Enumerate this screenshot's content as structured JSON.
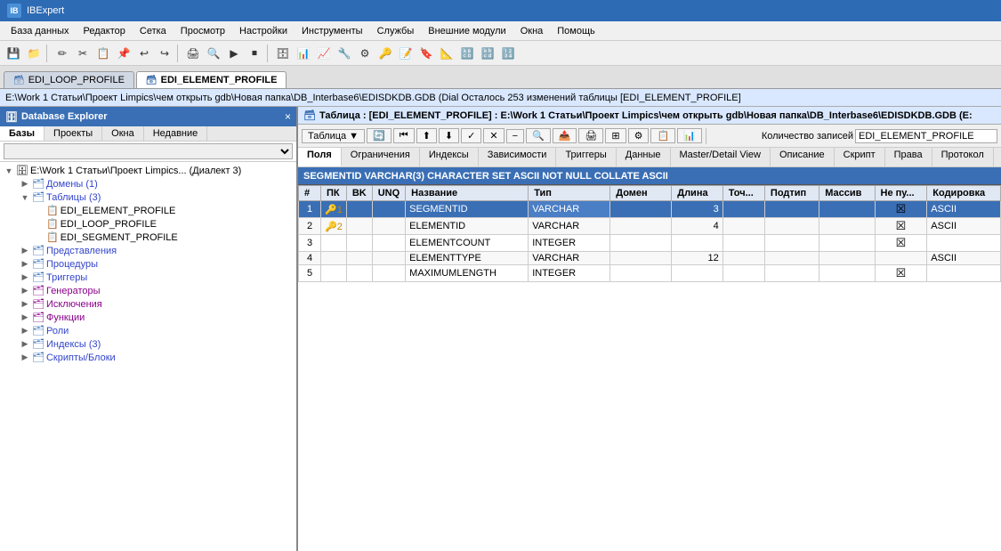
{
  "title_bar": {
    "icon": "IB",
    "title": "IBExpert"
  },
  "menu": {
    "items": [
      "База данных",
      "Редактор",
      "Сетка",
      "Просмотр",
      "Настройки",
      "Инструменты",
      "Службы",
      "Внешние модули",
      "Окна",
      "Помощь"
    ]
  },
  "tabs": [
    {
      "id": "edi_loop",
      "label": "EDI_LOOP_PROFILE",
      "active": false
    },
    {
      "id": "edi_element",
      "label": "EDI_ELEMENT_PROFILE",
      "active": true
    }
  ],
  "path_bar": {
    "text": "E:\\Work 1 Статьи\\Проект Limpics\\чем открыть gdb\\Новая папка\\DB_Interbase6\\EDISDKDB.GDB (Dial   Осталось 253 изменений таблицы [EDI_ELEMENT_PROFILE]"
  },
  "db_explorer": {
    "title": "Database Explorer",
    "close_btn": "×",
    "tabs": [
      "Базы",
      "Проекты",
      "Окна",
      "Недавние"
    ],
    "active_tab": "Базы",
    "filter_placeholder": "",
    "tree": {
      "root": {
        "label": "E:\\Work 1 Статьи\\Проект Limpics... (Диалект 3)",
        "expanded": true,
        "children": [
          {
            "label": "Домены (1)",
            "icon": "🗂",
            "expanded": false
          },
          {
            "label": "Таблицы (3)",
            "icon": "🗂",
            "expanded": true,
            "children": [
              {
                "label": "EDI_ELEMENT_PROFILE",
                "icon": "📋",
                "selected": false
              },
              {
                "label": "EDI_LOOP_PROFILE",
                "icon": "📋",
                "selected": false
              },
              {
                "label": "EDI_SEGMENT_PROFILE",
                "icon": "📋",
                "selected": false
              }
            ]
          },
          {
            "label": "Представления",
            "icon": "🗂",
            "expanded": false
          },
          {
            "label": "Процедуры",
            "icon": "🗂",
            "expanded": false
          },
          {
            "label": "Триггеры",
            "icon": "🗂",
            "expanded": false
          },
          {
            "label": "Генераторы",
            "icon": "🗂",
            "expanded": false
          },
          {
            "label": "Исключения",
            "icon": "🗂",
            "expanded": false
          },
          {
            "label": "Функции",
            "icon": "🗂",
            "expanded": false
          },
          {
            "label": "Роли",
            "icon": "🗂",
            "expanded": false
          },
          {
            "label": "Индексы (3)",
            "icon": "🗂",
            "expanded": false
          },
          {
            "label": "Скрипты/Блоки",
            "icon": "🗂",
            "expanded": false
          }
        ]
      }
    }
  },
  "right_panel": {
    "table_header": "Таблица : [EDI_ELEMENT_PROFILE] : E:\\Work 1 Статьи\\Проект Limpics\\чем открыть gdb\\Новая папка\\DB_Interbase6\\EDISDKDB.GDB (E:",
    "toolbar": {
      "table_btn": "Таблица ▼",
      "record_count_label": "Количество записей",
      "record_count_value": "EDI_ELEMENT_PROFILE"
    },
    "sub_tabs": [
      "Поля",
      "Ограничения",
      "Индексы",
      "Зависимости",
      "Триггеры",
      "Данные",
      "Master/Detail View",
      "Описание",
      "Скрипт",
      "Права",
      "Протокол"
    ],
    "active_sub_tab": "Поля",
    "sql_info": "SEGMENTID VARCHAR(3) CHARACTER SET ASCII NOT NULL COLLATE ASCII",
    "table": {
      "columns": [
        "#",
        "ПК",
        "BK",
        "UNQ",
        "Название",
        "Тип",
        "Домен",
        "Длина",
        "Точ...",
        "Подтип",
        "Массив",
        "Не пу...",
        "Кодировка"
      ],
      "rows": [
        {
          "num": "1",
          "pk": "🔑1",
          "bk": "",
          "unq": "",
          "name": "SEGMENTID",
          "type": "VARCHAR",
          "domain": "",
          "len": "3",
          "prec": "",
          "sub": "",
          "arr": "",
          "notnull": "☒",
          "enc": "ASCII",
          "selected": true
        },
        {
          "num": "2",
          "pk": "🔑2",
          "bk": "",
          "unq": "",
          "name": "ELEMENTID",
          "type": "VARCHAR",
          "domain": "",
          "len": "4",
          "prec": "",
          "sub": "",
          "arr": "",
          "notnull": "☒",
          "enc": "ASCII",
          "selected": false
        },
        {
          "num": "3",
          "pk": "",
          "bk": "",
          "unq": "",
          "name": "ELEMENTCOUNT",
          "type": "INTEGER",
          "domain": "",
          "len": "",
          "prec": "",
          "sub": "",
          "arr": "",
          "notnull": "☒",
          "enc": "",
          "selected": false
        },
        {
          "num": "4",
          "pk": "",
          "bk": "",
          "unq": "",
          "name": "ELEMENTTYPE",
          "type": "VARCHAR",
          "domain": "",
          "len": "12",
          "prec": "",
          "sub": "",
          "arr": "",
          "notnull": "",
          "enc": "ASCII",
          "selected": false
        },
        {
          "num": "5",
          "pk": "",
          "bk": "",
          "unq": "",
          "name": "MAXIMUMLENGTH",
          "type": "INTEGER",
          "domain": "",
          "len": "",
          "prec": "",
          "sub": "",
          "arr": "",
          "notnull": "☒",
          "enc": "",
          "selected": false
        }
      ]
    }
  },
  "toolbar_icons": {
    "file_icons": [
      "💾",
      "📂",
      "✏",
      "✂",
      "📋",
      "📌",
      "↩",
      "↪",
      "🖨",
      "🔍",
      "🔧",
      "⚙",
      "▶",
      "⏹",
      "📊"
    ],
    "edit_icons": [
      "🔠",
      "🔡",
      "🔢",
      "🔣"
    ]
  }
}
